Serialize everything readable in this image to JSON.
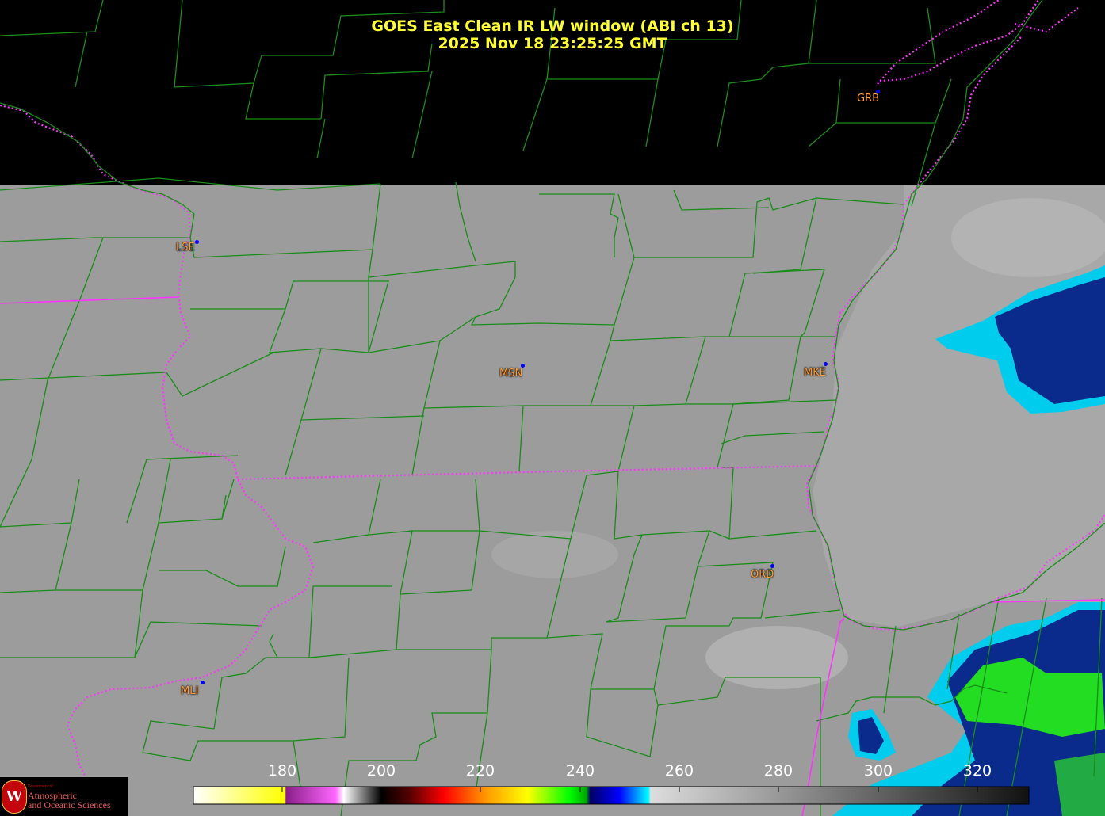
{
  "header": {
    "title_line1": "GOES East Clean IR LW window (ABI ch 13)",
    "title_line2": "2025 Nov 18  23:25:25 GMT"
  },
  "stations": [
    {
      "id": "lse",
      "label": "LSE"
    },
    {
      "id": "msn",
      "label": "MSN"
    },
    {
      "id": "mke",
      "label": "MKE"
    },
    {
      "id": "ord",
      "label": "ORD"
    },
    {
      "id": "mli",
      "label": "MLI"
    },
    {
      "id": "grb",
      "label": "GRB"
    }
  ],
  "colorbar": {
    "ticks": [
      "180",
      "200",
      "220",
      "240",
      "260",
      "280",
      "300",
      "320"
    ]
  },
  "logo": {
    "department": "Department of",
    "line1": "Atmospheric",
    "line2": "and Oceanic Sciences",
    "seal_letter": "W"
  },
  "colors": {
    "title": "#ffff33",
    "county_lines": "#1a8c1a",
    "state_border": "#ff33ff",
    "station_label": "#ff9933",
    "station_dot": "#0000ff",
    "cloud_cold_blue": "#0a2a8c",
    "cloud_cyan": "#00e5ff",
    "cloud_green": "#22dd22"
  }
}
